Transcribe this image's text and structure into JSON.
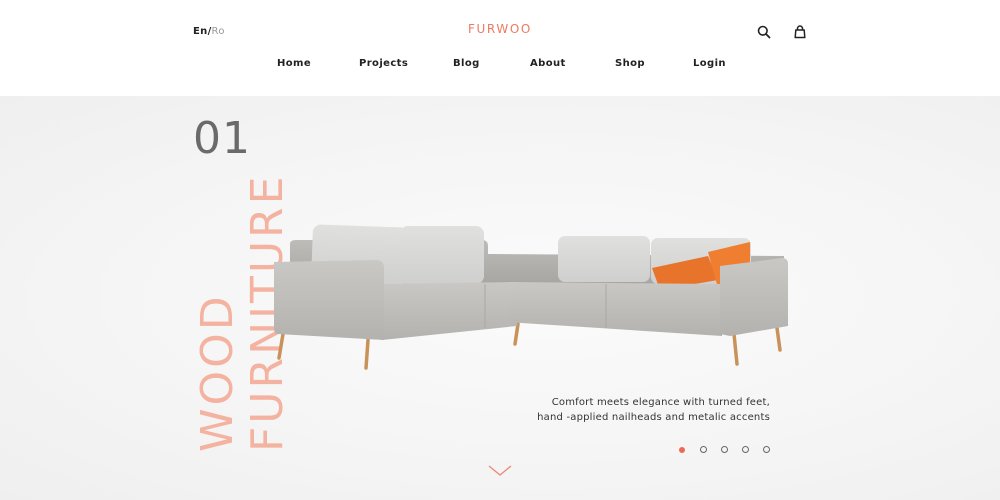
{
  "header": {
    "language": {
      "current": "En",
      "separator": "/",
      "other": "Ro"
    },
    "logo": "FURWOO",
    "icons": {
      "search": "search-icon",
      "cart": "shopping-bag-icon"
    },
    "nav": [
      {
        "label": "Home"
      },
      {
        "label": "Projects"
      },
      {
        "label": "Blog"
      },
      {
        "label": "About"
      },
      {
        "label": "Shop"
      },
      {
        "label": "Login"
      }
    ]
  },
  "hero": {
    "slide_number": "01",
    "title_line1": "WOOD",
    "title_line2": "FURNITURE",
    "image": "grey-sectional-sofa-with-orange-pillows",
    "description_line1": "Comfort meets elegance with turned feet,",
    "description_line2": "hand -applied nailheads and metalic accents",
    "slider": {
      "total": 5,
      "active_index": 0
    },
    "scroll_icon": "chevron-down-icon"
  },
  "colors": {
    "accent": "#ec7a62",
    "title_accent": "#f4b2a1",
    "text_dark": "#222222",
    "slide_number": "#6a6a6a",
    "dot_active": "#ec6a55"
  }
}
